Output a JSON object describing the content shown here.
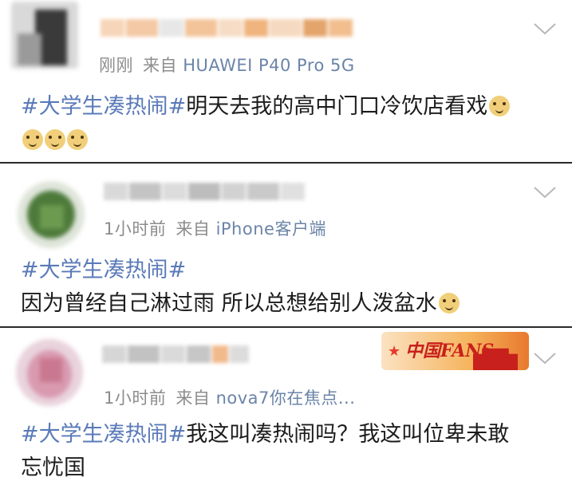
{
  "posts": [
    {
      "time": "刚刚",
      "from_label": "来自",
      "source": "HUAWEI P40 Pro 5G",
      "topic": "#大学生凑热闹#",
      "text": "明天去我的高中门口冷饮店看戏"
    },
    {
      "time": "1小时前",
      "from_label": "来自",
      "source": "iPhone客户端",
      "topic": "#大学生凑热闹#",
      "text": "因为曾经自己淋过雨 所以总想给别人泼盆水"
    },
    {
      "time": "1小时前",
      "from_label": "来自",
      "source": "nova7你在焦点...",
      "topic": "#大学生凑热闹#",
      "text": "我这叫凑热闹吗？我这叫位卑未敢",
      "text2": "忘忧国"
    }
  ],
  "badge": {
    "label": "中国FANS"
  },
  "icons": {
    "chevron": "chevron-down-icon",
    "emoji": "doge-emoji-icon"
  },
  "colors": {
    "topic": "#5a7ab8",
    "meta": "#8c8c8c",
    "divider": "#2a2a2a"
  }
}
